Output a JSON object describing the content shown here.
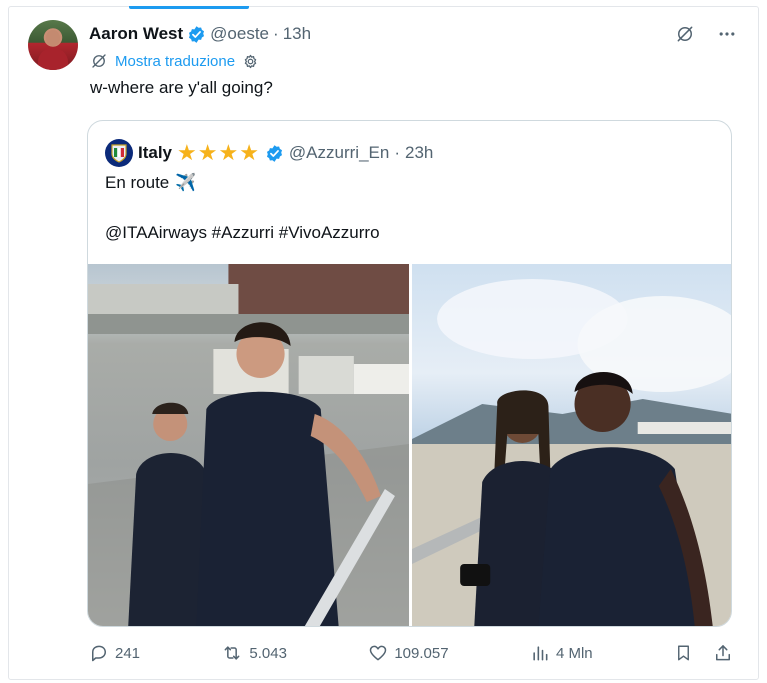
{
  "tweet": {
    "author_name": "Aaron West",
    "handle": "@oeste",
    "separator": "·",
    "time": "13h",
    "translate_label": "Mostra traduzione",
    "text": "w-where are y'all going?"
  },
  "quote": {
    "author_name": "Italy",
    "stars": "★★★★",
    "handle": "@Azzurri_En",
    "separator": "·",
    "time": "23h",
    "line1": "En route",
    "line1_emoji": "✈️",
    "line2": "@ITAAirways #Azzurri #VivoAzzurro"
  },
  "actions": {
    "replies": "241",
    "reposts": "5.043",
    "likes": "109.057",
    "views": "4 Mln"
  },
  "colors": {
    "accent": "#1d9bf0",
    "muted": "#536471",
    "star": "#f6b21b"
  },
  "icons": [
    "verified-badge-icon",
    "grok-icon",
    "more-icon",
    "translate-icon",
    "settings-icon",
    "airplane-icon",
    "reply-icon",
    "repost-icon",
    "like-icon",
    "views-icon",
    "bookmark-icon",
    "share-icon"
  ]
}
